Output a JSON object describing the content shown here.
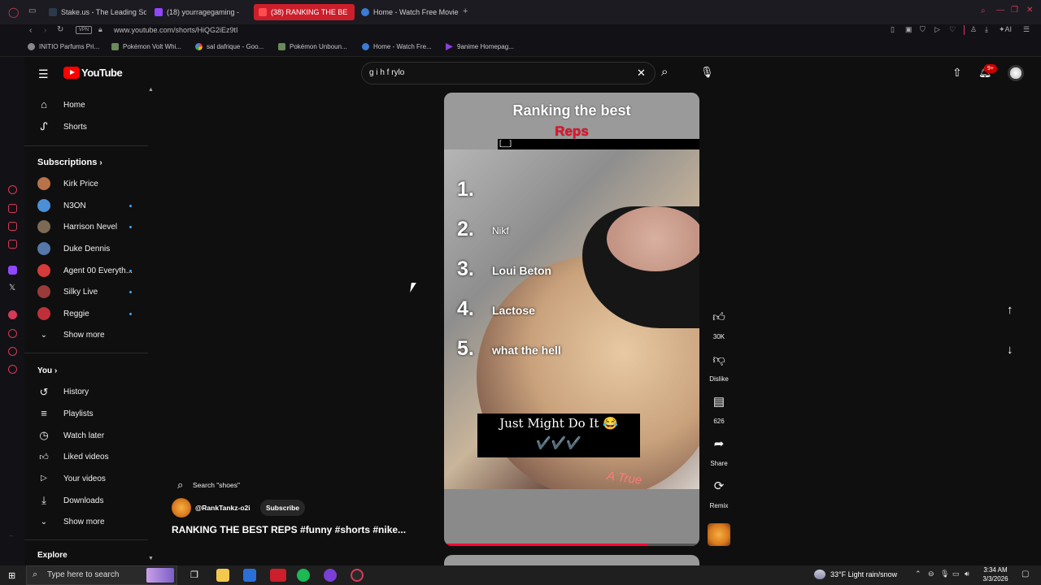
{
  "browser": {
    "tabs": [
      {
        "label": "Stake.us - The Leading So",
        "active": false
      },
      {
        "label": "(18) yourragegaming -",
        "active": false
      },
      {
        "label": "(38) RANKING THE BE",
        "active": true
      },
      {
        "label": "Home - Watch Free Movie",
        "active": false
      }
    ],
    "vpn_label": "VPN",
    "url": "www.youtube.com/shorts/HiQG2iEz9tI",
    "bookmarks": [
      "INITIO Parfums Pri...",
      "Pokémon Volt Whi...",
      "sal dafrique - Goo...",
      "Pokémon Unboun...",
      "Home - Watch Fre...",
      "9anime Homepag..."
    ],
    "ai_label": "AI"
  },
  "youtube": {
    "logo_text": "YouTube",
    "search_value": "g i h f rylo",
    "notification_badge": "9+"
  },
  "sidebar": {
    "main": [
      {
        "label": "Home",
        "icon": "home-icon"
      },
      {
        "label": "Shorts",
        "icon": "shorts-icon"
      }
    ],
    "subscriptions_title": "Subscriptions",
    "subscriptions": [
      {
        "label": "Kirk Price",
        "color": "#b8734a",
        "dot": false
      },
      {
        "label": "N3ON",
        "color": "#4b8fd6",
        "dot": true
      },
      {
        "label": "Harrison Nevel",
        "color": "#7d6a55",
        "dot": true
      },
      {
        "label": "Duke Dennis",
        "color": "#5577aa",
        "dot": false
      },
      {
        "label": "Agent 00 Everyth...",
        "color": "#d63a3a",
        "dot": true
      },
      {
        "label": "Silky Live",
        "color": "#9a3a3a",
        "dot": true
      },
      {
        "label": "Reggie",
        "color": "#c0303a",
        "dot": true
      }
    ],
    "show_more_1": "Show more",
    "you_title": "You",
    "you_items": [
      {
        "label": "History",
        "icon": "history-icon"
      },
      {
        "label": "Playlists",
        "icon": "playlists-icon"
      },
      {
        "label": "Watch later",
        "icon": "clock-icon"
      },
      {
        "label": "Liked videos",
        "icon": "thumbs-up-icon"
      },
      {
        "label": "Your videos",
        "icon": "play-icon"
      },
      {
        "label": "Downloads",
        "icon": "download-icon"
      }
    ],
    "show_more_2": "Show more",
    "explore_title": "Explore"
  },
  "short": {
    "title_line1": "Ranking the best",
    "title_line2": "Reps",
    "blank_box": "[__]",
    "rank_numbers": [
      "1.",
      "2.",
      "3.",
      "4.",
      "5."
    ],
    "rank_items": [
      "",
      "Nikf",
      "Loui Beton",
      "Lactose",
      "what the hell"
    ],
    "caption_line1": "Just Might Do It 😂",
    "caption_line2": "✔️✔️✔️",
    "watermark": "A True",
    "search_suggestion": "Search \"shoes\"",
    "channel": "@RankTankz-o2i",
    "subscribe_label": "Subscribe",
    "video_title": "RANKING THE BEST REPS #funny #shorts #nike...",
    "progress": 0.8
  },
  "actions": {
    "like_count": "30K",
    "dislike_label": "Dislike",
    "comment_count": "626",
    "share_label": "Share",
    "remix_label": "Remix"
  },
  "taskbar": {
    "search_placeholder": "Type here to search",
    "weather": "33°F  Light rain/snow",
    "time": "3:34 AM",
    "date": "3/3/2026"
  }
}
